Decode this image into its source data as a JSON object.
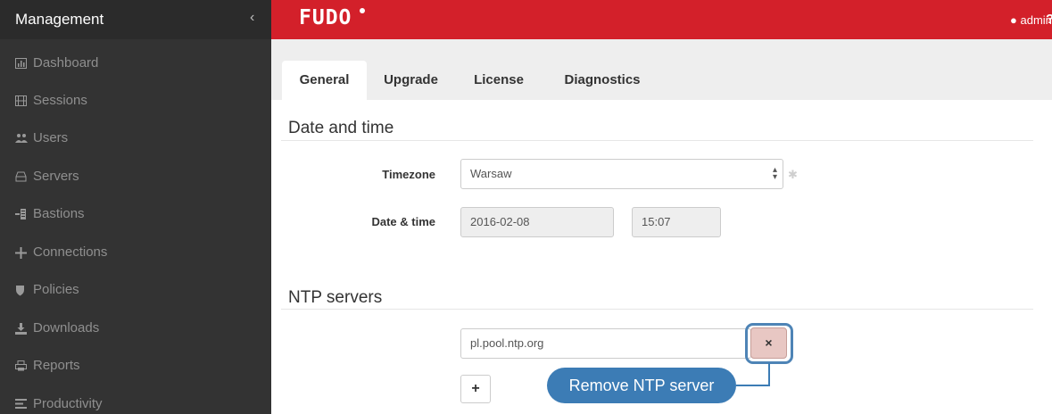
{
  "sidebar": {
    "title": "Management",
    "collapse_glyph": "‹",
    "items": [
      {
        "label": "Dashboard",
        "icon": "chart-icon"
      },
      {
        "label": "Sessions",
        "icon": "film-icon"
      },
      {
        "label": "Users",
        "icon": "users-icon"
      },
      {
        "label": "Servers",
        "icon": "server-icon"
      },
      {
        "label": "Bastions",
        "icon": "bastion-icon"
      },
      {
        "label": "Connections",
        "icon": "connections-icon"
      },
      {
        "label": "Policies",
        "icon": "shield-icon"
      },
      {
        "label": "Downloads",
        "icon": "download-icon"
      },
      {
        "label": "Reports",
        "icon": "printer-icon"
      },
      {
        "label": "Productivity",
        "icon": "list-icon"
      }
    ]
  },
  "topbar": {
    "logo": "FUDO",
    "user": "admin",
    "help_glyph": "?"
  },
  "tabs": [
    {
      "label": "General",
      "active": true
    },
    {
      "label": "Upgrade",
      "active": false
    },
    {
      "label": "License",
      "active": false
    },
    {
      "label": "Diagnostics",
      "active": false
    }
  ],
  "date_section": {
    "title": "Date and time",
    "timezone_label": "Timezone",
    "timezone_value": "Warsaw",
    "datetime_label": "Date & time",
    "date_value": "2016-02-08",
    "time_value": "15:07"
  },
  "ntp_section": {
    "title": "NTP servers",
    "server_value": "pl.pool.ntp.org",
    "remove_glyph": "×",
    "add_glyph": "+"
  },
  "callout": {
    "text": "Remove NTP server"
  },
  "colors": {
    "brand_red": "#d3202a",
    "sidebar_bg": "#333333",
    "callout_blue": "#3c7cb5",
    "remove_button_bg": "#e8c7c3"
  }
}
